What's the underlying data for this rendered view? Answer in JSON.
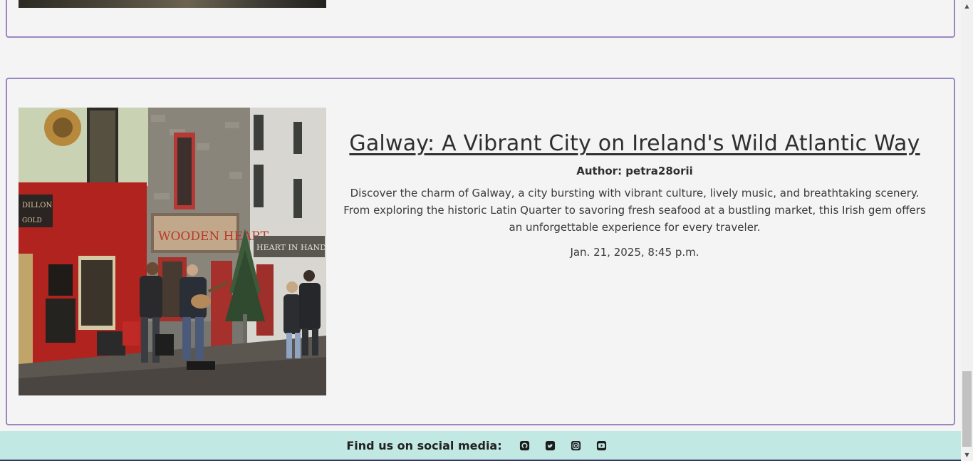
{
  "post": {
    "title": "Galway: A Vibrant City on Ireland's Wild Atlantic Way",
    "author": "Author: petra28orii",
    "excerpt": "Discover the charm of Galway, a city bursting with vibrant culture, lively music, and breathtaking scenery. From exploring the historic Latin Quarter to savoring fresh seafood at a bustling market, this Irish gem offers an unforgettable experience for every traveler.",
    "date": "Jan. 21, 2025, 8:45 p.m.",
    "photo": {
      "sign_wooden_heart": "WOODEN HEART",
      "sign_dillon": "DILLON",
      "sign_gold": "GOLD",
      "sign_heart_in_hands": "HEART IN HANDS"
    }
  },
  "footer": {
    "label": "Find us on social media:",
    "icons": [
      "github-icon",
      "twitter-icon",
      "instagram-icon",
      "youtube-icon"
    ]
  },
  "colors": {
    "card_border": "#9b87c0",
    "footer_bg": "#c1e8e3",
    "page_bg": "#f4f4f4"
  }
}
